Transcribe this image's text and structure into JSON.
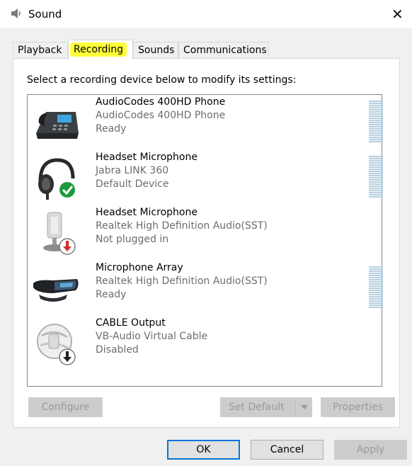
{
  "window": {
    "title": "Sound",
    "close_glyph": "✕"
  },
  "tabs": [
    {
      "label": "Playback"
    },
    {
      "label": "Recording"
    },
    {
      "label": "Sounds"
    },
    {
      "label": "Communications"
    }
  ],
  "active_tab": "Recording",
  "highlight_color": "#ffff3a",
  "instruction": "Select a recording device below to modify its settings:",
  "devices": [
    {
      "name": "AudioCodes 400HD Phone",
      "driver": "AudioCodes 400HD Phone",
      "status": "Ready",
      "icon": "desk-phone-icon",
      "level_meter": true
    },
    {
      "name": "Headset Microphone",
      "driver": "Jabra LINK 360",
      "status": "Default Device",
      "icon": "headset-icon",
      "badge": "default-check-icon",
      "level_meter": true
    },
    {
      "name": "Headset Microphone",
      "driver": "Realtek High Definition Audio(SST)",
      "status": "Not plugged in",
      "icon": "microphone-icon",
      "badge": "unplugged-arrow-icon",
      "level_meter": false
    },
    {
      "name": "Microphone Array",
      "driver": "Realtek High Definition Audio(SST)",
      "status": "Ready",
      "icon": "microphone-array-icon",
      "level_meter": true
    },
    {
      "name": "CABLE Output",
      "driver": "VB-Audio Virtual Cable",
      "status": "Disabled",
      "icon": "virtual-cable-icon",
      "badge": "disabled-arrow-icon",
      "level_meter": false
    }
  ],
  "buttons": {
    "configure": "Configure",
    "set_default": "Set Default",
    "properties": "Properties",
    "ok": "OK",
    "cancel": "Cancel",
    "apply": "Apply"
  },
  "colors": {
    "accent": "#0078d7",
    "meter": "#b5cfe0",
    "check_badge": "#1c9b3e",
    "unplugged_badge": "#d12b2b"
  }
}
